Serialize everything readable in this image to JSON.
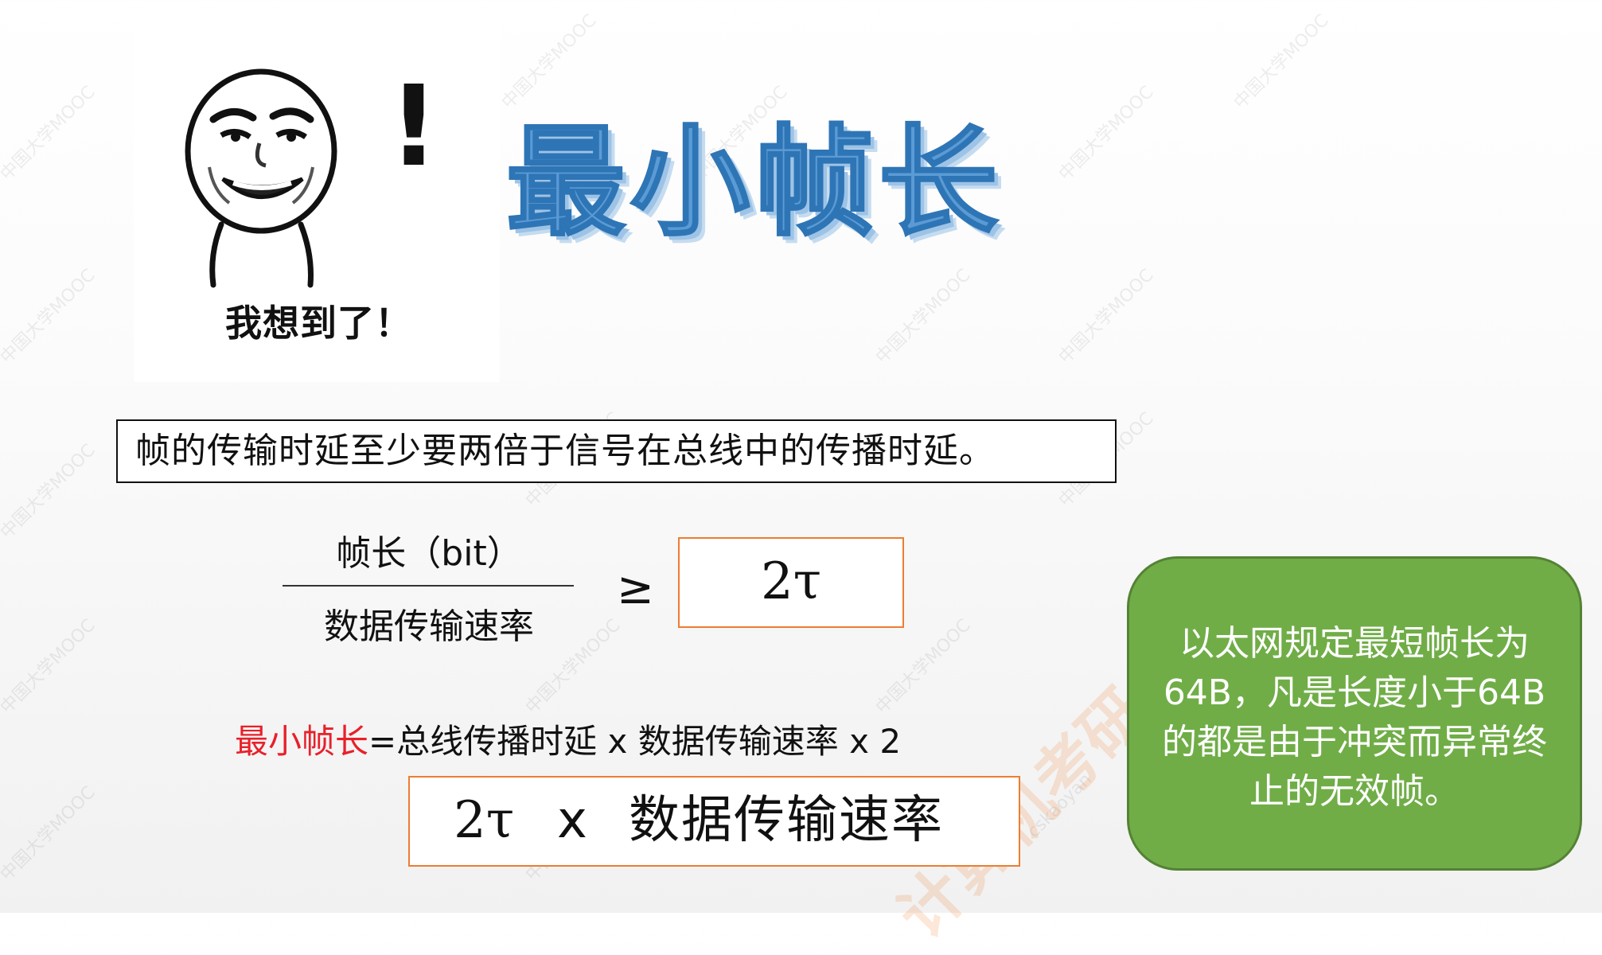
{
  "meme": {
    "icon": "surprised-face-meme",
    "exclamation": "!",
    "caption": "我想到了！"
  },
  "title": "最小帧长",
  "statement": "帧的传输时延至少要两倍于信号在总线中的传播时延。",
  "inequality": {
    "numerator": "帧长（bit）",
    "denominator": "数据传输速率",
    "operator": "≥",
    "rhs": "2τ"
  },
  "formula": {
    "lhs": "最小帧长",
    "rhs": "=总线传播时延 x 数据传输速率 x 2"
  },
  "result": {
    "term1": "2τ",
    "times": "x",
    "term2": "数据传输速率"
  },
  "note": "以太网规定最短帧长为64B，凡是长度小于64B的都是由于冲突而异常终止的无效帧。",
  "watermark": {
    "text": "中国大学MOOC",
    "site": "cskaoyan"
  },
  "colors": {
    "title": "#5b9bd5",
    "formula_highlight": "#e8202a",
    "box_border": "#ed7d31",
    "note_bg": "#70ad47"
  }
}
